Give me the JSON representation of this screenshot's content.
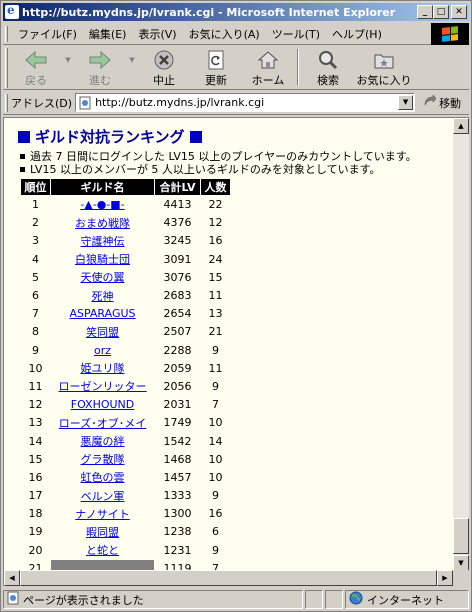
{
  "window": {
    "title": "http://butz.mydns.jp/lvrank.cgi - Microsoft Internet Explorer"
  },
  "menubar": {
    "items": [
      "ファイル(F)",
      "編集(E)",
      "表示(V)",
      "お気に入り(A)",
      "ツール(T)",
      "ヘルプ(H)"
    ]
  },
  "toolbar": {
    "back_label": "戻る",
    "forward_label": "進む",
    "stop_label": "中止",
    "refresh_label": "更新",
    "home_label": "ホーム",
    "search_label": "検索",
    "favorites_label": "お気に入り"
  },
  "address": {
    "label": "アドレス(D)",
    "url": "http://butz.mydns.jp/lvrank.cgi",
    "go_label": "移動"
  },
  "page": {
    "heading": "ギルド対抗ランキング",
    "notes": [
      "過去 7 日間にログインした LV15 以上のプレイヤーのみカウントしています。",
      "LV15 以上のメンバーが 5 人以上いるギルドのみを対象としています。"
    ],
    "table": {
      "headers": [
        "順位",
        "ギルド名",
        "合計LV",
        "人数"
      ],
      "rows": [
        {
          "rank": "1",
          "guild": "-▲-●-■-",
          "lv": "4413",
          "count": "22"
        },
        {
          "rank": "2",
          "guild": "おまめ戦隊",
          "lv": "4376",
          "count": "12"
        },
        {
          "rank": "3",
          "guild": "守護神伝",
          "lv": "3245",
          "count": "16"
        },
        {
          "rank": "4",
          "guild": "白狼騎士団",
          "lv": "3091",
          "count": "24"
        },
        {
          "rank": "5",
          "guild": "天使の翼",
          "lv": "3076",
          "count": "15"
        },
        {
          "rank": "6",
          "guild": "死神",
          "lv": "2683",
          "count": "11"
        },
        {
          "rank": "7",
          "guild": "ASPARAGUS",
          "lv": "2654",
          "count": "13"
        },
        {
          "rank": "8",
          "guild": "笑同盟",
          "lv": "2507",
          "count": "21"
        },
        {
          "rank": "9",
          "guild": "orz",
          "lv": "2288",
          "count": "9"
        },
        {
          "rank": "10",
          "guild": "姫ユリ隊",
          "lv": "2059",
          "count": "11"
        },
        {
          "rank": "11",
          "guild": "ローゼンリッター",
          "lv": "2056",
          "count": "9"
        },
        {
          "rank": "12",
          "guild": "FOXHOUND",
          "lv": "2031",
          "count": "7"
        },
        {
          "rank": "13",
          "guild": "ローズ･オブ･メイ",
          "lv": "1749",
          "count": "10"
        },
        {
          "rank": "14",
          "guild": "悪魔の絆",
          "lv": "1542",
          "count": "14"
        },
        {
          "rank": "15",
          "guild": "グラ散隊",
          "lv": "1468",
          "count": "10"
        },
        {
          "rank": "16",
          "guild": "虹色の雲",
          "lv": "1457",
          "count": "10"
        },
        {
          "rank": "17",
          "guild": "ベルン軍",
          "lv": "1333",
          "count": "9"
        },
        {
          "rank": "18",
          "guild": "ナノサイト",
          "lv": "1300",
          "count": "16"
        },
        {
          "rank": "19",
          "guild": "暇同盟",
          "lv": "1238",
          "count": "6"
        },
        {
          "rank": "20",
          "guild": "と蛇と",
          "lv": "1231",
          "count": "9"
        },
        {
          "rank": "21",
          "guild": "",
          "lv": "1119",
          "count": "7"
        }
      ]
    }
  },
  "statusbar": {
    "status_text": "ページが表示されました",
    "zone_text": "インターネット"
  },
  "colors": {
    "title_gradient_start": "#0a246a",
    "page_background": "#fffff0",
    "heading": "#0000a0",
    "link": "#0000ee"
  }
}
